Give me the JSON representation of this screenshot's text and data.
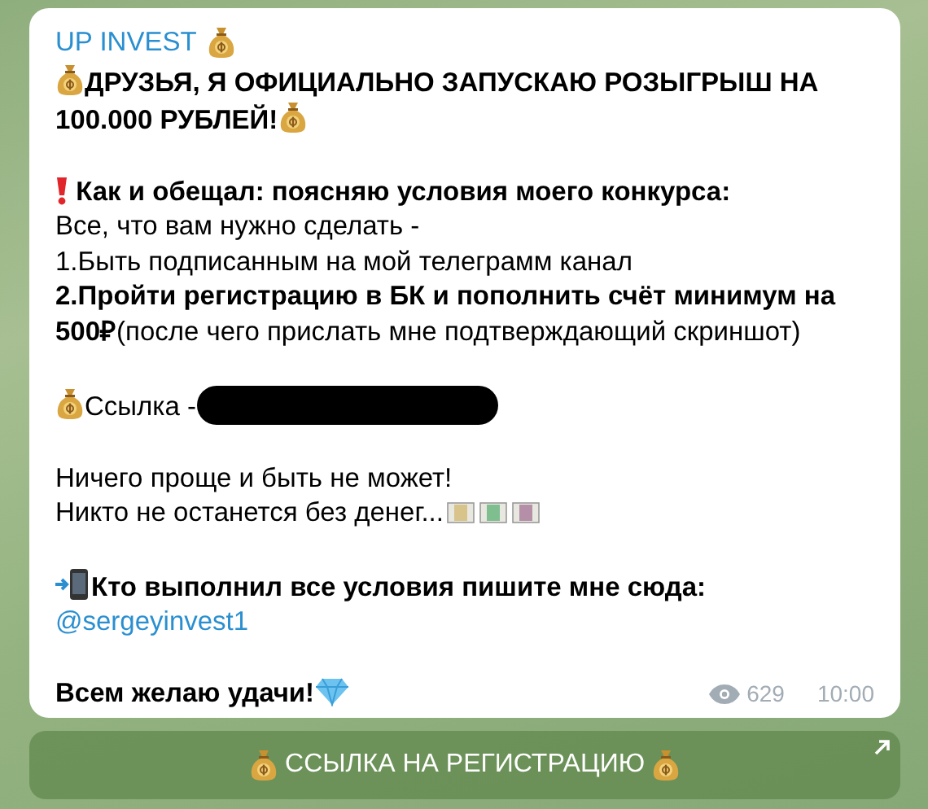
{
  "channel": {
    "name": "UP INVEST"
  },
  "paragraphs": [
    [
      {
        "kind": "headline",
        "text": "ДРУЗЬЯ, Я ОФИЦИАЛЬНО ЗАПУСКАЮ РОЗЫГРЫШ НА"
      },
      {
        "kind": "headline_end",
        "text": "100.000 РУБЛЕЙ!"
      }
    ],
    [
      {
        "kind": "alert",
        "text": "Как и обещал: поясняю условия моего конкурса:"
      },
      {
        "kind": "plain",
        "text": "Все, что вам нужно сделать -"
      },
      {
        "kind": "plain",
        "text": "1.Быть подписанным на мой телеграмм канал"
      },
      {
        "kind": "plain",
        "text": "**2.Пройти регистрацию в БК и пополнить счёт минимум на 500₽**(после чего прислать мне подтверждающий скриншот)"
      }
    ],
    [
      {
        "kind": "link",
        "text": "Ссылка -"
      }
    ],
    [
      {
        "kind": "plain",
        "text": "Ничего проще и быть не может!"
      },
      {
        "kind": "money",
        "text": "Никто не останется без денег..."
      }
    ],
    [
      {
        "kind": "contact",
        "text": "Кто выполнил все условия пишите мне сюда:"
      },
      {
        "kind": "mention",
        "text": "@sergeyinvest1"
      }
    ],
    [
      {
        "kind": "wish",
        "text": "Всем желаю удачи!"
      }
    ]
  ],
  "views": "629",
  "time": "10:00",
  "button": {
    "label": "ССЫЛКА НА РЕГИСТРАЦИЮ"
  }
}
